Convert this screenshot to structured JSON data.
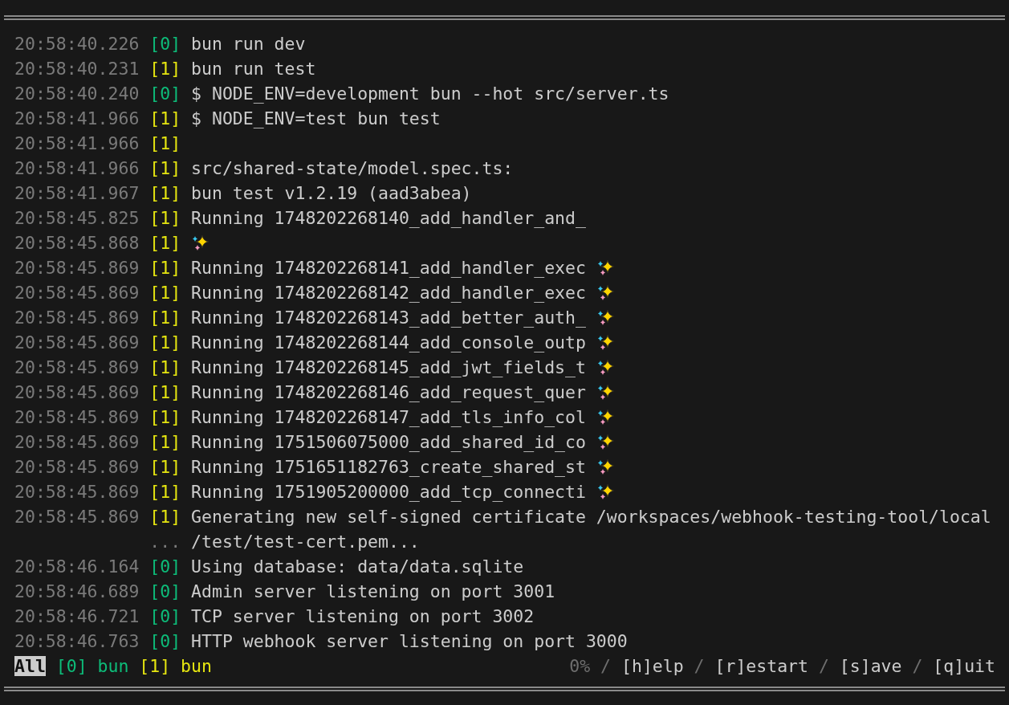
{
  "log": [
    {
      "kind": "line",
      "time": "20:58:40.226",
      "tag": "[0]",
      "color": "#0dbc79",
      "text": "bun run dev",
      "sparkle": false
    },
    {
      "kind": "line",
      "time": "20:58:40.231",
      "tag": "[1]",
      "color": "#e5e510",
      "text": "bun run test",
      "sparkle": false
    },
    {
      "kind": "line",
      "time": "20:58:40.240",
      "tag": "[0]",
      "color": "#0dbc79",
      "text": "$ NODE_ENV=development bun --hot src/server.ts",
      "sparkle": false
    },
    {
      "kind": "line",
      "time": "20:58:41.966",
      "tag": "[1]",
      "color": "#e5e510",
      "text": "$ NODE_ENV=test bun test",
      "sparkle": false
    },
    {
      "kind": "line",
      "time": "20:58:41.966",
      "tag": "[1]",
      "color": "#e5e510",
      "sparkle": false
    },
    {
      "kind": "line",
      "time": "20:58:41.966",
      "tag": "[1]",
      "color": "#e5e510",
      "text": "src/shared-state/model.spec.ts:",
      "sparkle": false
    },
    {
      "kind": "line",
      "time": "20:58:41.967",
      "tag": "[1]",
      "color": "#e5e510",
      "text": "bun test v1.2.19 (aad3abea)",
      "sparkle": false
    },
    {
      "kind": "line",
      "time": "20:58:45.825",
      "tag": "[1]",
      "color": "#e5e510",
      "text": "Running 1748202268140_add_handler_and_",
      "sparkle": false
    },
    {
      "kind": "line",
      "time": "20:58:45.868",
      "tag": "[1]",
      "color": "#e5e510",
      "sparkle": true
    },
    {
      "kind": "line",
      "time": "20:58:45.869",
      "tag": "[1]",
      "color": "#e5e510",
      "text": "Running 1748202268141_add_handler_exec",
      "sparkle": true
    },
    {
      "kind": "line",
      "time": "20:58:45.869",
      "tag": "[1]",
      "color": "#e5e510",
      "text": "Running 1748202268142_add_handler_exec",
      "sparkle": true
    },
    {
      "kind": "line",
      "time": "20:58:45.869",
      "tag": "[1]",
      "color": "#e5e510",
      "text": "Running 1748202268143_add_better_auth_",
      "sparkle": true
    },
    {
      "kind": "line",
      "time": "20:58:45.869",
      "tag": "[1]",
      "color": "#e5e510",
      "text": "Running 1748202268144_add_console_outp",
      "sparkle": true
    },
    {
      "kind": "line",
      "time": "20:58:45.869",
      "tag": "[1]",
      "color": "#e5e510",
      "text": "Running 1748202268145_add_jwt_fields_t",
      "sparkle": true
    },
    {
      "kind": "line",
      "time": "20:58:45.869",
      "tag": "[1]",
      "color": "#e5e510",
      "text": "Running 1748202268146_add_request_quer",
      "sparkle": true
    },
    {
      "kind": "line",
      "time": "20:58:45.869",
      "tag": "[1]",
      "color": "#e5e510",
      "text": "Running 1748202268147_add_tls_info_col",
      "sparkle": true
    },
    {
      "kind": "line",
      "time": "20:58:45.869",
      "tag": "[1]",
      "color": "#e5e510",
      "text": "Running 1751506075000_add_shared_id_co",
      "sparkle": true
    },
    {
      "kind": "line",
      "time": "20:58:45.869",
      "tag": "[1]",
      "color": "#e5e510",
      "text": "Running 1751651182763_create_shared_st",
      "sparkle": true
    },
    {
      "kind": "line",
      "time": "20:58:45.869",
      "tag": "[1]",
      "color": "#e5e510",
      "text": "Running 1751905200000_add_tcp_connecti",
      "sparkle": true
    },
    {
      "kind": "line",
      "time": "20:58:45.869",
      "tag": "[1]",
      "color": "#e5e510",
      "text": "Generating new self-signed certificate /workspaces/webhook-testing-tool/local",
      "sparkle": false
    },
    {
      "kind": "wrap",
      "prefix": "...",
      "text": "/test/test-cert.pem..."
    },
    {
      "kind": "line",
      "time": "20:58:46.164",
      "tag": "[0]",
      "color": "#0dbc79",
      "text": "Using database: data/data.sqlite",
      "sparkle": false
    },
    {
      "kind": "line",
      "time": "20:58:46.689",
      "tag": "[0]",
      "color": "#0dbc79",
      "text": "Admin server listening on port 3001",
      "sparkle": false
    },
    {
      "kind": "line",
      "time": "20:58:46.721",
      "tag": "[0]",
      "color": "#0dbc79",
      "text": "TCP server listening on port 3002",
      "sparkle": false
    },
    {
      "kind": "line",
      "time": "20:58:46.763",
      "tag": "[0]",
      "color": "#0dbc79",
      "text": "HTTP webhook server listening on port 3000",
      "sparkle": false
    }
  ],
  "status_bar": {
    "filters": [
      {
        "label": "All",
        "selected": true
      },
      {
        "label": "[0] bun",
        "selected": false,
        "color": "#0dbc79"
      },
      {
        "label": "[1] bun",
        "selected": false,
        "color": "#e5e510"
      }
    ],
    "hints": [
      {
        "kind": "percent",
        "text": "0%"
      },
      {
        "kind": "separator",
        "text": "/"
      },
      {
        "kind": "key",
        "text": "[h]elp"
      },
      {
        "kind": "separator",
        "text": "/"
      },
      {
        "kind": "key",
        "text": "[r]estart"
      },
      {
        "kind": "separator",
        "text": "/"
      },
      {
        "kind": "key",
        "text": "[s]ave"
      },
      {
        "kind": "separator",
        "text": "/"
      },
      {
        "kind": "key",
        "text": "[q]uit"
      }
    ]
  }
}
